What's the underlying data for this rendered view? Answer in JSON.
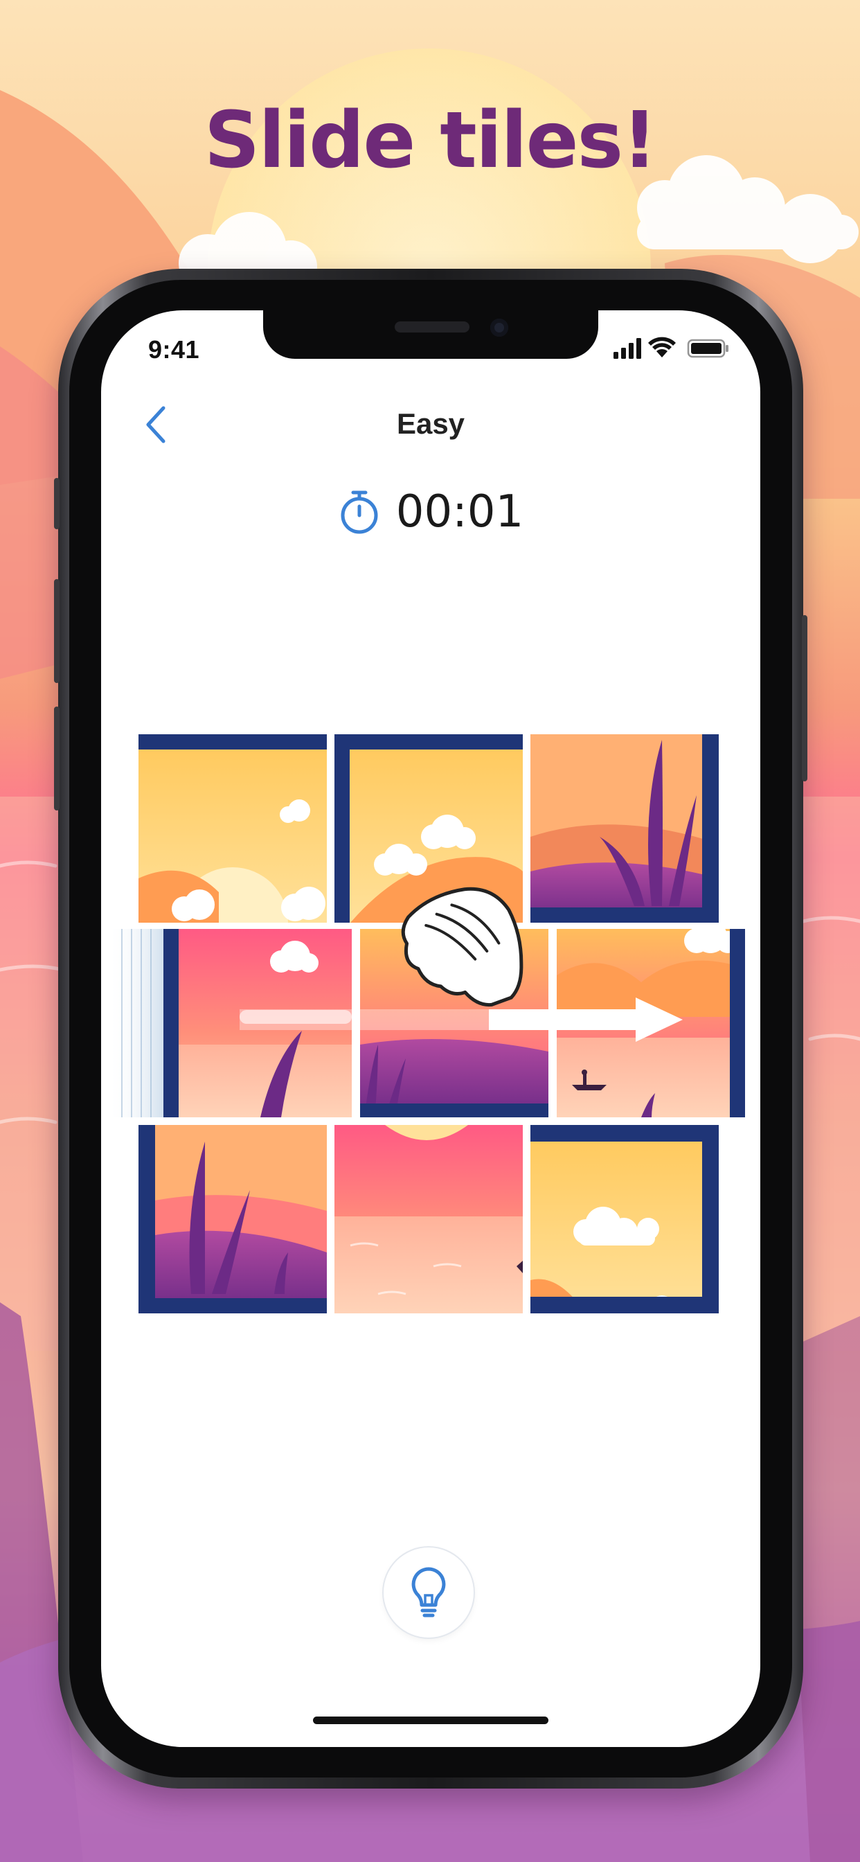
{
  "promo": {
    "headline": "Slide tiles!"
  },
  "status_bar": {
    "time": "9:41",
    "signal_icon": "cellular-signal-icon",
    "wifi_icon": "wifi-icon",
    "battery_icon": "battery-icon"
  },
  "nav": {
    "back_icon": "chevron-left-icon",
    "title": "Easy"
  },
  "timer": {
    "icon": "stopwatch-icon",
    "value": "00:01"
  },
  "puzzle": {
    "grid": "3x3",
    "sliding_row": 2,
    "gesture": "swipe-right",
    "gesture_icon": "hand-pointer-icon"
  },
  "hint_button": {
    "icon": "lightbulb-icon"
  },
  "colors": {
    "accent": "#3b82d6",
    "headline": "#6e2a78",
    "tile_frame": "#1f3577",
    "sky_pink": "#ff5f8a",
    "sun_yellow": "#ffd064",
    "hill_purple": "#7b2a8a"
  }
}
